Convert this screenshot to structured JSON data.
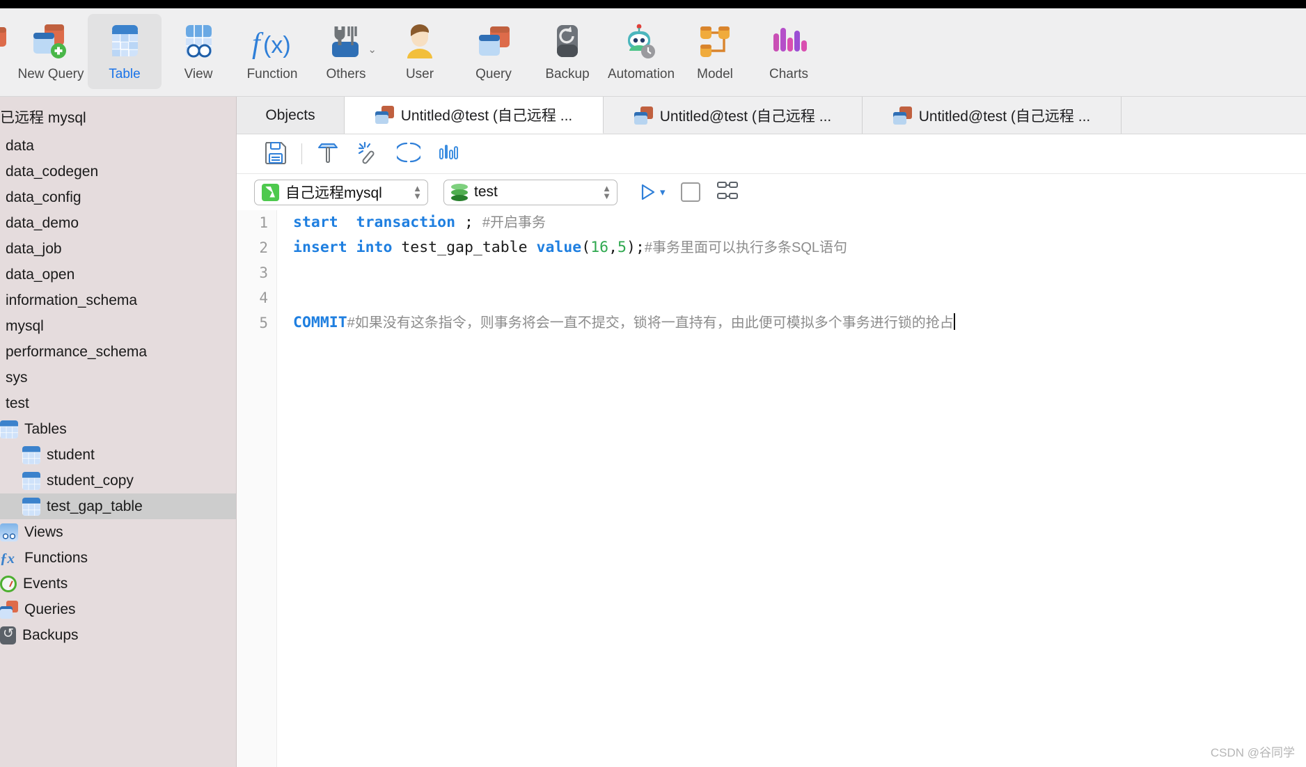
{
  "toolbar": {
    "items": [
      {
        "label": "",
        "icon": "connection-icon",
        "selected": false
      },
      {
        "label": "New Query",
        "icon": "new-query-icon",
        "selected": false
      },
      {
        "label": "Table",
        "icon": "table-icon",
        "selected": true
      },
      {
        "label": "View",
        "icon": "view-icon",
        "selected": false
      },
      {
        "label": "Function",
        "icon": "function-fx-icon",
        "selected": false
      },
      {
        "label": "Others",
        "icon": "others-tools-icon",
        "selected": false,
        "caret": "⌄"
      },
      {
        "label": "User",
        "icon": "user-icon",
        "selected": false
      },
      {
        "label": "Query",
        "icon": "query-icon",
        "selected": false
      },
      {
        "label": "Backup",
        "icon": "backup-icon",
        "selected": false
      },
      {
        "label": "Automation",
        "icon": "automation-robot-icon",
        "selected": false
      },
      {
        "label": "Model",
        "icon": "model-icon",
        "selected": false
      },
      {
        "label": "Charts",
        "icon": "charts-icon",
        "selected": false
      }
    ]
  },
  "sidebar": {
    "connection": "已远程 mysql",
    "databases": [
      "data",
      "data_codegen",
      "data_config",
      "data_demo",
      "data_job",
      "data_open",
      "information_schema",
      "mysql",
      "performance_schema",
      "sys",
      "test"
    ],
    "nodes": [
      {
        "label": "Tables",
        "icon": "table-icon",
        "indent": "node",
        "selected": false
      },
      {
        "label": "student",
        "icon": "table-icon",
        "indent": "leaf",
        "selected": false
      },
      {
        "label": "student_copy",
        "icon": "table-icon",
        "indent": "leaf",
        "selected": false
      },
      {
        "label": "test_gap_table",
        "icon": "table-icon",
        "indent": "leaf",
        "selected": true
      },
      {
        "label": "Views",
        "icon": "view-icon",
        "indent": "node",
        "selected": false
      },
      {
        "label": "Functions",
        "icon": "function-fx-icon",
        "indent": "node",
        "selected": false
      },
      {
        "label": "Events",
        "icon": "event-clock-icon",
        "indent": "node",
        "selected": false
      },
      {
        "label": "Queries",
        "icon": "query-icon",
        "indent": "node",
        "selected": false
      },
      {
        "label": "Backups",
        "icon": "backup-icon",
        "indent": "node",
        "selected": false
      }
    ]
  },
  "tabs": [
    {
      "label": "Objects",
      "kind": "objects",
      "active": false
    },
    {
      "label": "Untitled@test (自己远程 ...",
      "kind": "doc",
      "active": true
    },
    {
      "label": "Untitled@test (自己远程 ...",
      "kind": "doc",
      "active": false
    },
    {
      "label": "Untitled@test (自己远程 ...",
      "kind": "doc",
      "active": false
    }
  ],
  "editor_toolbar": {
    "buttons": [
      {
        "name": "save-icon"
      },
      {
        "name": "separator"
      },
      {
        "name": "format-sql-icon"
      },
      {
        "name": "magic-wand-icon"
      },
      {
        "name": "parentheses-icon"
      },
      {
        "name": "explain-chart-icon"
      }
    ]
  },
  "connection_bar": {
    "connection_value": "自己远程mysql",
    "database_value": "test",
    "run_label": "▷",
    "run_caret": "▾"
  },
  "code": {
    "lines": [
      {
        "n": "1",
        "parts": [
          {
            "t": "start",
            "c": "kw"
          },
          {
            "t": "  ",
            "c": ""
          },
          {
            "t": "transaction",
            "c": "kw"
          },
          {
            "t": " ; ",
            "c": ""
          },
          {
            "t": "#开启事务",
            "c": "cm"
          }
        ]
      },
      {
        "n": "2",
        "parts": [
          {
            "t": "insert",
            "c": "kw"
          },
          {
            "t": " ",
            "c": ""
          },
          {
            "t": "into",
            "c": "kw"
          },
          {
            "t": " test_gap_table ",
            "c": ""
          },
          {
            "t": "value",
            "c": "kw"
          },
          {
            "t": "(",
            "c": ""
          },
          {
            "t": "16",
            "c": "num"
          },
          {
            "t": ",",
            "c": ""
          },
          {
            "t": "5",
            "c": "num"
          },
          {
            "t": ");",
            "c": ""
          },
          {
            "t": "#事务里面可以执行多条SQL语句",
            "c": "cm"
          }
        ]
      },
      {
        "n": "3",
        "parts": []
      },
      {
        "n": "4",
        "parts": []
      },
      {
        "n": "5",
        "parts": [
          {
            "t": "COMMIT",
            "c": "kw"
          },
          {
            "t": "#如果没有这条指令，则事务将会一直不提交，锁将一直持有，由此便可模拟多个事务进行锁的抢占",
            "c": "cm"
          }
        ]
      }
    ]
  },
  "watermark": "CSDN @谷同学"
}
